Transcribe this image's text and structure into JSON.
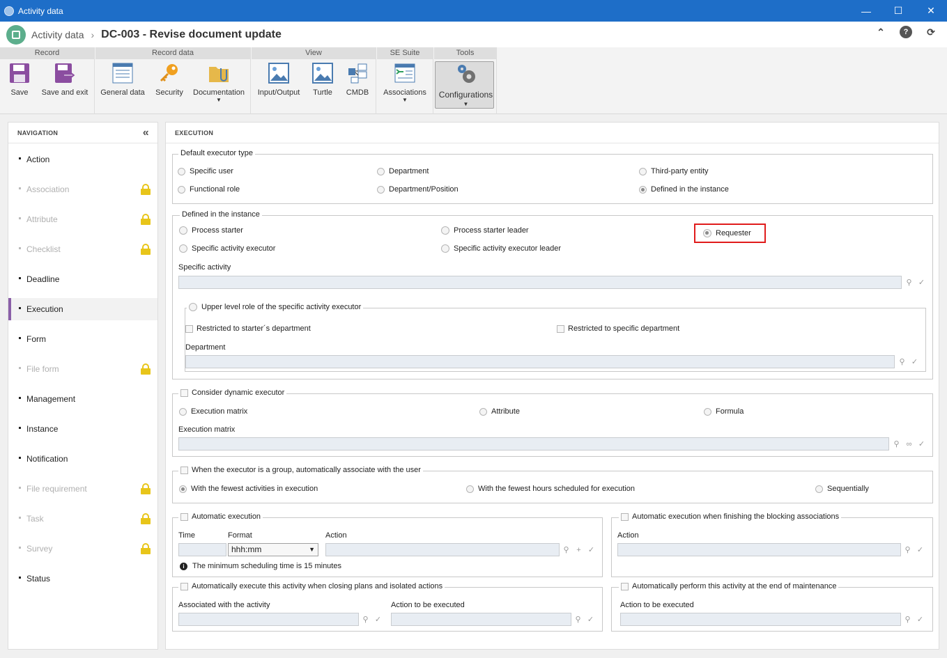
{
  "window": {
    "title": "Activity data"
  },
  "appbar": {
    "app_name": "Activity data",
    "separator": "›",
    "doc_title": "DC-003 - Revise document update"
  },
  "ribbon": {
    "groups": [
      "Record",
      "Record data",
      "View",
      "SE Suite",
      "Tools"
    ],
    "buttons": {
      "save": "Save",
      "save_exit": "Save and exit",
      "general": "General data",
      "security": "Security",
      "documentation": "Documentation",
      "input_output": "Input/Output",
      "turtle": "Turtle",
      "cmdb": "CMDB",
      "associations": "Associations",
      "configurations": "Configurations"
    }
  },
  "nav": {
    "header": "NAVIGATION",
    "items": [
      {
        "label": "Action",
        "state": "enabled"
      },
      {
        "label": "Association",
        "state": "locked"
      },
      {
        "label": "Attribute",
        "state": "locked"
      },
      {
        "label": "Checklist",
        "state": "locked"
      },
      {
        "label": "Deadline",
        "state": "enabled"
      },
      {
        "label": "Execution",
        "state": "active"
      },
      {
        "label": "Form",
        "state": "enabled"
      },
      {
        "label": "File form",
        "state": "locked"
      },
      {
        "label": "Management",
        "state": "enabled"
      },
      {
        "label": "Instance",
        "state": "enabled"
      },
      {
        "label": "Notification",
        "state": "enabled"
      },
      {
        "label": "File requirement",
        "state": "locked"
      },
      {
        "label": "Task",
        "state": "locked"
      },
      {
        "label": "Survey",
        "state": "locked"
      },
      {
        "label": "Status",
        "state": "enabled"
      }
    ]
  },
  "main": {
    "header": "EXECUTION",
    "default_executor": {
      "legend": "Default executor type",
      "options": [
        "Specific user",
        "Department",
        "Third-party entity",
        "Functional role",
        "Department/Position",
        "Defined in the instance"
      ],
      "selected": "Defined in the instance"
    },
    "defined_instance": {
      "legend": "Defined in the instance",
      "options": [
        "Process starter",
        "Process starter leader",
        "Requester",
        "Specific activity executor",
        "Specific activity executor leader"
      ],
      "selected": "Requester",
      "specific_activity_label": "Specific activity",
      "upper_level": {
        "legend": "Upper level role of the specific activity executor",
        "restricted_starter": "Restricted to starter´s department",
        "restricted_specific": "Restricted to specific department",
        "department_label": "Department"
      }
    },
    "dynamic": {
      "legend": "Consider dynamic executor",
      "options": [
        "Execution matrix",
        "Attribute",
        "Formula"
      ],
      "matrix_label": "Execution matrix"
    },
    "group": {
      "legend": "When the executor is a group, automatically associate with the user",
      "options": [
        "With the fewest activities in execution",
        "With the fewest hours scheduled for execution",
        "Sequentially"
      ],
      "selected": "With the fewest activities in execution"
    },
    "auto_exec": {
      "legend": "Automatic execution",
      "time_label": "Time",
      "format_label": "Format",
      "format_value": "hhh:mm",
      "action_label": "Action",
      "info": "The minimum scheduling time is 15 minutes"
    },
    "auto_blocking": {
      "legend": "Automatic execution when finishing the blocking associations",
      "action_label": "Action"
    },
    "auto_plans": {
      "legend": "Automatically execute this activity when closing plans and isolated actions",
      "associated_label": "Associated with the activity",
      "action_label": "Action to be executed"
    },
    "auto_maint": {
      "legend": "Automatically perform this activity at the end of maintenance",
      "action_label": "Action to be executed"
    }
  },
  "colors": {
    "titlebar": "#1e6ec8",
    "nav_accent": "#8a5fa8",
    "lock": "#e8c51a",
    "highlight": "#e01b1b"
  }
}
